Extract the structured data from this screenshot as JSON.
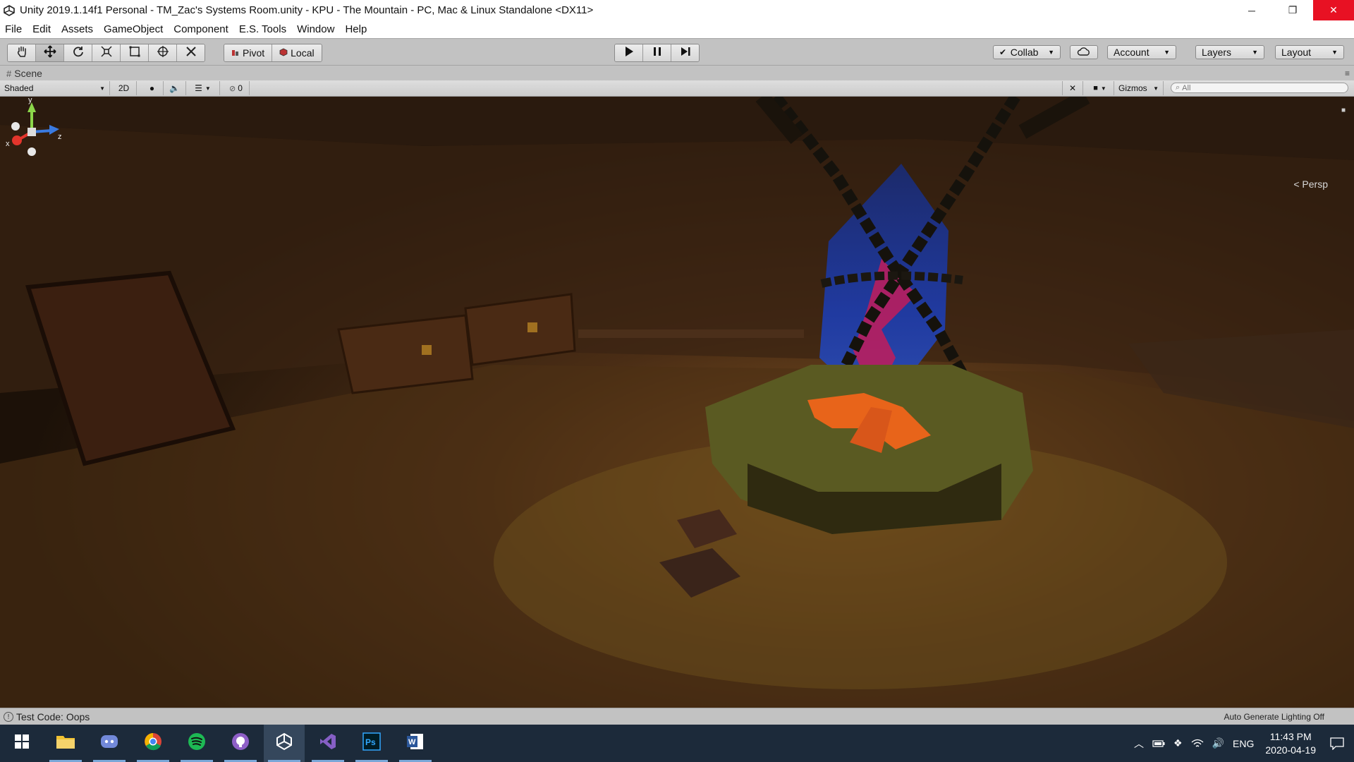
{
  "window": {
    "title": "Unity 2019.1.14f1 Personal - TM_Zac's Systems Room.unity - KPU - The Mountain - PC, Mac & Linux Standalone <DX11>",
    "app_icon": "unity-icon",
    "controls": {
      "minimize": "─",
      "restore": "❐",
      "close": "✕"
    }
  },
  "menu": {
    "items": [
      "File",
      "Edit",
      "Assets",
      "GameObject",
      "Component",
      "E.S. Tools",
      "Window",
      "Help"
    ]
  },
  "toolbar": {
    "tools": [
      "hand-tool",
      "move-tool",
      "rotate-tool",
      "scale-tool",
      "rect-tool",
      "transform-tool",
      "custom-tool"
    ],
    "active_tool": "move-tool",
    "pivot_label": "Pivot",
    "local_label": "Local",
    "playback": [
      "play",
      "pause",
      "step"
    ],
    "collab_label": "Collab",
    "account_label": "Account",
    "layers_label": "Layers",
    "layout_label": "Layout"
  },
  "scene": {
    "tab_label": "Scene",
    "shading_mode": "Shaded",
    "mode_2d": "2D",
    "hidden_count": "0",
    "gizmos_label": "Gizmos",
    "search_placeholder": "All",
    "persp_label": "Persp",
    "axis_labels": {
      "y": "y",
      "x": "x",
      "z": "z"
    }
  },
  "status": {
    "message": "Test Code: Oops",
    "lighting": "Auto Generate Lighting Off"
  },
  "taskbar": {
    "apps": [
      "windows-start",
      "file-explorer",
      "discord",
      "chrome",
      "spotify",
      "github-desktop",
      "unity",
      "visual-studio",
      "photoshop",
      "word"
    ],
    "active_app": "unity",
    "tray_language": "ENG",
    "time": "11:43 PM",
    "date": "2020-04-19"
  },
  "colors": {
    "titlebar_bg": "#ffffff",
    "close_btn": "#e81123",
    "editor_bg": "#c2c2c2",
    "taskbar_bg": "#1c2a3a",
    "axis_y": "#8bd64a",
    "axis_x": "#e3352c",
    "axis_z": "#3a7ae0"
  }
}
